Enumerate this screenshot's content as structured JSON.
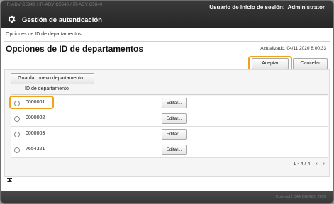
{
  "header": {
    "device_line": "iR-ADV C5840 / iR-ADV C5840 / iR-ADV C5840",
    "title": "Gestión de autenticación",
    "login_label": "Usuario de inicio de sesión:",
    "login_user": "Administrator"
  },
  "breadcrumb": "Opciones de ID de departamentos",
  "page_title": "Opciones de ID de departamentos",
  "updated": "Actualizado: 04/11 2020 8:00:33",
  "buttons": {
    "accept": "Aceptar",
    "cancel": "Cancelar",
    "new_department": "Guardar nuevo departamento..."
  },
  "table": {
    "column_header": "ID de departamento",
    "rows": [
      {
        "id": "0000001",
        "edit": "Editar..."
      },
      {
        "id": "0000002",
        "edit": "Editar..."
      },
      {
        "id": "0000003",
        "edit": "Editar..."
      },
      {
        "id": "7654321",
        "edit": "Editar..."
      }
    ]
  },
  "pager": {
    "range": "1 - 4 / 4",
    "prev_icon": "chevron-left-icon",
    "next_icon": "chevron-right-icon"
  },
  "footer": {
    "copyright": "Copyright CANON INC. 2020"
  },
  "colors": {
    "highlight": "#f0a31a",
    "topbar": "#2e2e2e"
  }
}
